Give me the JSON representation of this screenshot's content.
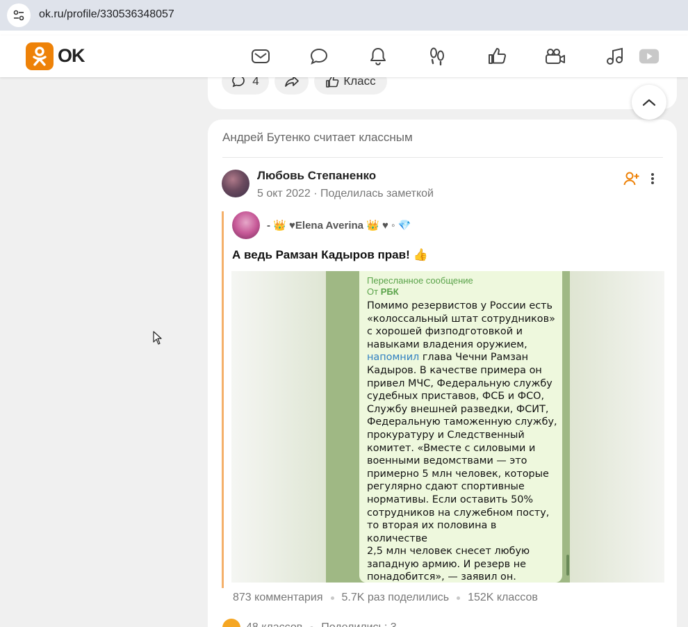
{
  "browser": {
    "url": "ok.ru/profile/330536348057",
    "site_info_icon": "tune-icon"
  },
  "header": {
    "logo_text": "OK",
    "brand_color": "#ee8208",
    "icons": [
      "mail-icon",
      "chat-icon",
      "bell-icon",
      "footprints-icon",
      "like-icon",
      "video-camera-icon",
      "music-icon",
      "play-icon"
    ]
  },
  "prev_post": {
    "comments_count": "4",
    "klass_label": "Класс"
  },
  "post": {
    "activity_text": "Андрей Бутенко считает классным",
    "author": "Любовь Степаненко",
    "meta": "5 окт 2022 · Поделилась заметкой",
    "quoted_author": "- 👑 ♥Elena Averina 👑 ♥ ◦ 💎",
    "title": "А ведь Рамзан Кадыров прав! 👍",
    "image": {
      "forwarded_label": "Пересланное сообщение",
      "forwarded_from": "От",
      "forwarded_source": "РБК",
      "text_before_link": "Помимо резервистов у России есть\n«колоссальный штат сотрудников»\nс хорошей физподготовкой и\nнавыками владения оружием,\n",
      "link_text": "напомнил",
      "text_after_link": " глава Чечни Рамзан\nКадыров. В качестве примера он\nпривел МЧС, Федеральную службу\nсудебных приставов, ФСБ и ФСО,\nСлужбу внешней разведки, ФСИТ,\nФедеральную таможенную службу,\nпрокуратуру и Следственный\nкомитет. «Вместе с силовыми и\nвоенными ведомствами — это\nпримерно 5 млн человек, которые\nрегулярно сдают спортивные\nнормативы. Если оставить 50%\nсотрудников на служебном посту,\nто вторая их половина в количестве\n2,5 млн человек снесет любую\nзападную армию. И резерв не\nпонадобится», — заявил он."
    },
    "stats": {
      "comments": "873 комментария",
      "shares": "5.7K раз поделились",
      "klasses": "152K классов"
    },
    "footer": {
      "klasses": "48 классов",
      "shared": "Поделились: 3"
    }
  }
}
